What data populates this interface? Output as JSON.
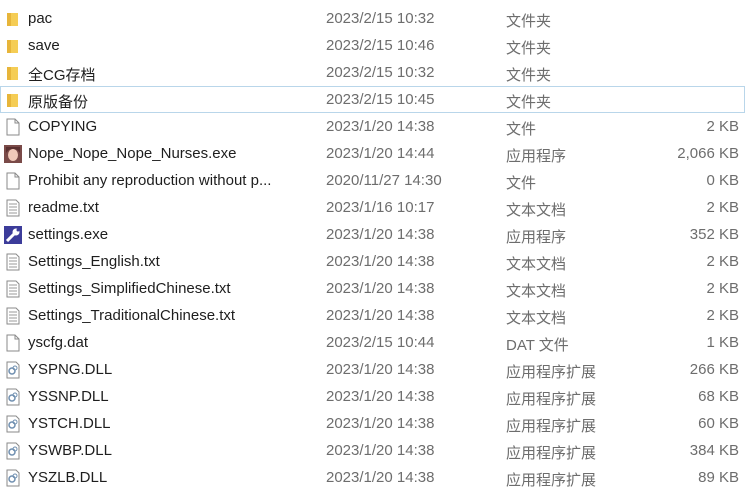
{
  "selected_index": 3,
  "files": [
    {
      "name": "pac",
      "date": "2023/2/15 10:32",
      "type": "文件夹",
      "size": "",
      "icon": "folder"
    },
    {
      "name": "save",
      "date": "2023/2/15 10:46",
      "type": "文件夹",
      "size": "",
      "icon": "folder"
    },
    {
      "name": "全CG存档",
      "date": "2023/2/15 10:32",
      "type": "文件夹",
      "size": "",
      "icon": "folder"
    },
    {
      "name": "原版备份",
      "date": "2023/2/15 10:45",
      "type": "文件夹",
      "size": "",
      "icon": "folder"
    },
    {
      "name": "COPYING",
      "date": "2023/1/20 14:38",
      "type": "文件",
      "size": "2 KB",
      "icon": "file"
    },
    {
      "name": "Nope_Nope_Nope_Nurses.exe",
      "date": "2023/1/20 14:44",
      "type": "应用程序",
      "size": "2,066 KB",
      "icon": "app-avatar"
    },
    {
      "name": "Prohibit any reproduction without p...",
      "date": "2020/11/27 14:30",
      "type": "文件",
      "size": "0 KB",
      "icon": "file"
    },
    {
      "name": "readme.txt",
      "date": "2023/1/16 10:17",
      "type": "文本文档",
      "size": "2 KB",
      "icon": "text"
    },
    {
      "name": "settings.exe",
      "date": "2023/1/20 14:38",
      "type": "应用程序",
      "size": "352 KB",
      "icon": "wrench-app"
    },
    {
      "name": "Settings_English.txt",
      "date": "2023/1/20 14:38",
      "type": "文本文档",
      "size": "2 KB",
      "icon": "text"
    },
    {
      "name": "Settings_SimplifiedChinese.txt",
      "date": "2023/1/20 14:38",
      "type": "文本文档",
      "size": "2 KB",
      "icon": "text"
    },
    {
      "name": "Settings_TraditionalChinese.txt",
      "date": "2023/1/20 14:38",
      "type": "文本文档",
      "size": "2 KB",
      "icon": "text"
    },
    {
      "name": "yscfg.dat",
      "date": "2023/2/15 10:44",
      "type": "DAT 文件",
      "size": "1 KB",
      "icon": "file"
    },
    {
      "name": "YSPNG.DLL",
      "date": "2023/1/20 14:38",
      "type": "应用程序扩展",
      "size": "266 KB",
      "icon": "dll"
    },
    {
      "name": "YSSNP.DLL",
      "date": "2023/1/20 14:38",
      "type": "应用程序扩展",
      "size": "68 KB",
      "icon": "dll"
    },
    {
      "name": "YSTCH.DLL",
      "date": "2023/1/20 14:38",
      "type": "应用程序扩展",
      "size": "60 KB",
      "icon": "dll"
    },
    {
      "name": "YSWBP.DLL",
      "date": "2023/1/20 14:38",
      "type": "应用程序扩展",
      "size": "384 KB",
      "icon": "dll"
    },
    {
      "name": "YSZLB.DLL",
      "date": "2023/1/20 14:38",
      "type": "应用程序扩展",
      "size": "89 KB",
      "icon": "dll"
    }
  ]
}
